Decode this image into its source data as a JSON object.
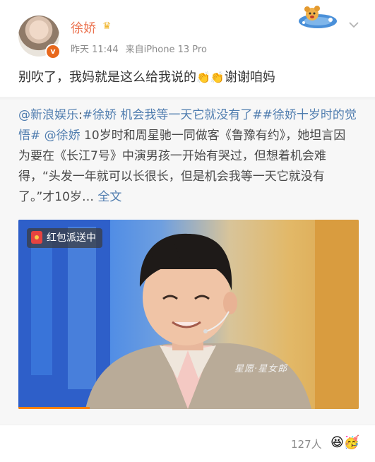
{
  "post": {
    "username": "徐娇",
    "crown_icon": "crown-icon",
    "time": "昨天 11:44",
    "source": "来自iPhone 13 Pro",
    "text_before": "别吹了，我妈就是这么给我说的",
    "hands": "👏👏",
    "text_after": "谢谢咱妈"
  },
  "repost": {
    "author": "@新浪娱乐",
    "colon": ":",
    "tag1": "#徐娇 机会我等一天它就没有了#",
    "tag2": "#徐娇十岁时的觉悟#",
    "mention": "@徐娇",
    "body": " 10岁时和周星驰一同做客《鲁豫有约》，她坦言因为要在《长江7号》中演男孩一开始有哭过，但想着机会难得，“头发一年就可以长很长，但是机会我等一天它就没有了。”才10岁…",
    "full_text_link": "全文"
  },
  "video": {
    "badge_label": "红包派送中",
    "watermark": "星愿·星女郎",
    "progress_fraction": 0.21
  },
  "footer": {
    "count_label": "127人",
    "emoji": "😆🥳"
  },
  "colors": {
    "username": "#eb7350",
    "link": "#507daf",
    "progress": "#ff8200"
  }
}
